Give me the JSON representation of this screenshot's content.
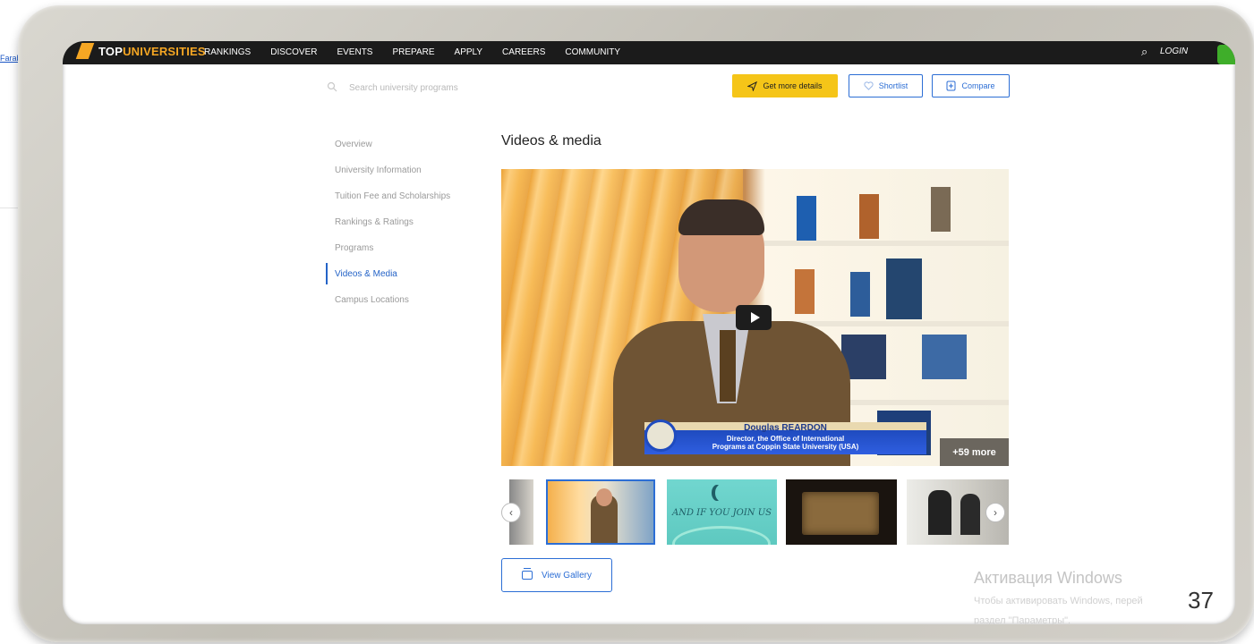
{
  "background_link": "Farab",
  "nav": {
    "logo_a": "TOP",
    "logo_b": "UNIVERSITIES",
    "links": [
      "RANKINGS",
      "DISCOVER",
      "EVENTS",
      "PREPARE",
      "APPLY",
      "CAREERS",
      "COMMUNITY"
    ],
    "search_glyph": "⌕",
    "login": "LOGIN"
  },
  "toolbar": {
    "search_placeholder": "Search university programs",
    "details_label": "Get more details",
    "shortlist_label": "Shortlist",
    "compare_label": "Compare"
  },
  "side_menu": {
    "items": [
      "Overview",
      "University Information",
      "Tuition Fee and Scholarships",
      "Rankings & Ratings",
      "Programs",
      "Videos & Media",
      "Campus Locations"
    ],
    "active": "Videos & Media"
  },
  "main": {
    "heading": "Videos & media",
    "video": {
      "name": "Douglas REARDON",
      "caption_line1": "Director, the Office of International",
      "caption_line2": "Programs at Coppin State University (USA)",
      "more": "+59 more"
    },
    "thumbnail_text": "AND IF YOU JOIN US",
    "gallery_label": "View Gallery"
  },
  "watermark": {
    "title": "Активация Windows",
    "line1": "Чтобы активировать Windows, перей",
    "line2": "раздел \"Параметры\"."
  },
  "slide_number": "37",
  "colors": {
    "accent": "#2c6ed5",
    "cta": "#f5c518",
    "nav": "#1b1b1b"
  },
  "icons": [
    "search-icon",
    "send-icon",
    "heart-icon",
    "compare-icon",
    "play-icon",
    "chevron-left-icon",
    "chevron-right-icon",
    "gallery-icon"
  ]
}
